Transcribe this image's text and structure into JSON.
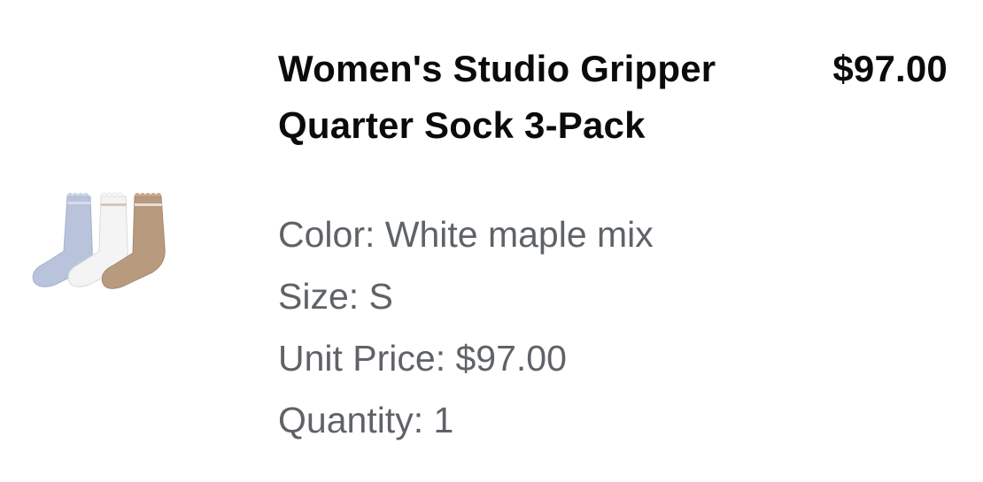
{
  "product": {
    "title": "Women's Studio Gripper Quarter Sock 3-Pack",
    "price": "$97.00",
    "image_alt": "three-pack of quarter socks in light blue, white and tan"
  },
  "details": {
    "color": "Color: White maple mix",
    "size": "Size: S",
    "unit_price": "Unit Price: $97.00",
    "quantity": "Quantity: 1"
  },
  "colors": {
    "sock_blue": "#b9c4dc",
    "sock_white": "#f4f4f4",
    "sock_tan": "#b89a7e",
    "title_text": "#0b0b0b",
    "detail_text": "#5f6368"
  }
}
